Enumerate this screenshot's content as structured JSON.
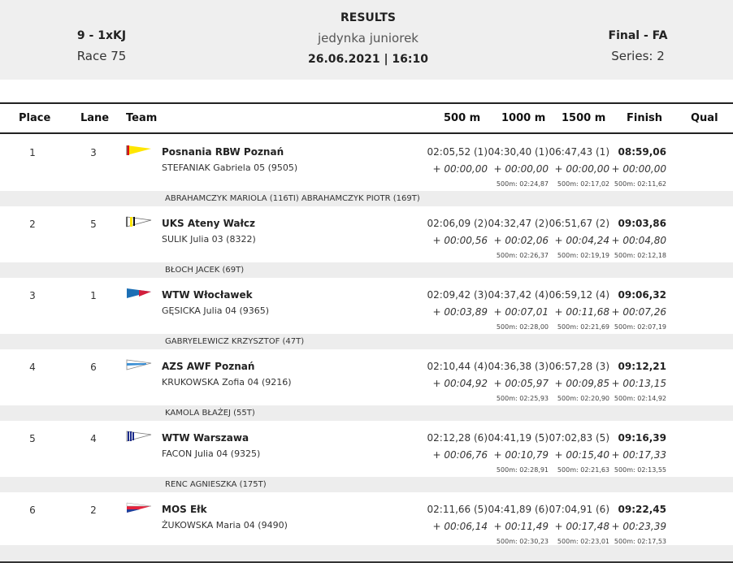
{
  "header": {
    "event_code": "9 - 1xKJ",
    "race": "Race 75",
    "title": "RESULTS",
    "event_name": "jedynka juniorek",
    "datetime": "26.06.2021 | 16:10",
    "phase": "Final - FA",
    "series": "Series: 2"
  },
  "columns": {
    "place": "Place",
    "lane": "Lane",
    "team": "Team",
    "m500": "500 m",
    "m1000": "1000 m",
    "m1500": "1500 m",
    "finish": "Finish",
    "qual": "Qual"
  },
  "rows": [
    {
      "place": "1",
      "lane": "3",
      "flag_icon": "flag-yellow-red",
      "club": "Posnania RBW Poznań",
      "athlete": "STEFANIAK  Gabriela 05 (9505)",
      "t500": "02:05,52 (1)",
      "t1000": "04:30,40 (1)",
      "t1500": "06:47,43 (1)",
      "finish": "08:59,06",
      "d500": "+ 00:00,00",
      "d1000": "+ 00:00,00",
      "d1500": "+ 00:00,00",
      "dfin": "+ 00:00,00",
      "s1000": "500m: 02:24,87",
      "s1500": "500m: 02:17,02",
      "sfin": "500m: 02:11,62",
      "coach": "ABRAHAMCZYK MARIOLA (116TI) ABRAHAMCZYK PIOTR (169T)"
    },
    {
      "place": "2",
      "lane": "5",
      "flag_icon": "flag-white-yellow-stripes",
      "club": "UKS Ateny Wałcz",
      "athlete": "SULIK  Julia 03 (8322)",
      "t500": "02:06,09 (2)",
      "t1000": "04:32,47 (2)",
      "t1500": "06:51,67 (2)",
      "finish": "09:03,86",
      "d500": "+ 00:00,56",
      "d1000": "+ 00:02,06",
      "d1500": "+ 00:04,24",
      "dfin": "+ 00:04,80",
      "s1000": "500m: 02:26,37",
      "s1500": "500m: 02:19,19",
      "sfin": "500m: 02:12,18",
      "coach": "BŁOCH JACEK (69T)"
    },
    {
      "place": "3",
      "lane": "1",
      "flag_icon": "flag-blue-red",
      "club": "WTW Włocławek",
      "athlete": "GĘSICKA  Julia 04 (9365)",
      "t500": "02:09,42 (3)",
      "t1000": "04:37,42 (4)",
      "t1500": "06:59,12 (4)",
      "finish": "09:06,32",
      "d500": "+ 00:03,89",
      "d1000": "+ 00:07,01",
      "d1500": "+ 00:11,68",
      "dfin": "+ 00:07,26",
      "s1000": "500m: 02:28,00",
      "s1500": "500m: 02:21,69",
      "sfin": "500m: 02:07,19",
      "coach": "GABRYELEWICZ KRZYSZTOF (47T)"
    },
    {
      "place": "4",
      "lane": "6",
      "flag_icon": "flag-white-blue",
      "club": "AZS AWF Poznań",
      "athlete": "KRUKOWSKA  Zofia 04 (9216)",
      "t500": "02:10,44 (4)",
      "t1000": "04:36,38 (3)",
      "t1500": "06:57,28 (3)",
      "finish": "09:12,21",
      "d500": "+ 00:04,92",
      "d1000": "+ 00:05,97",
      "d1500": "+ 00:09,85",
      "dfin": "+ 00:13,15",
      "s1000": "500m: 02:25,93",
      "s1500": "500m: 02:20,90",
      "sfin": "500m: 02:14,92",
      "coach": "KAMOLA BŁAŻEJ (55T)"
    },
    {
      "place": "5",
      "lane": "4",
      "flag_icon": "flag-white-blue-stripes",
      "club": "WTW Warszawa",
      "athlete": "FACON  Julia 04 (9325)",
      "t500": "02:12,28 (6)",
      "t1000": "04:41,19 (5)",
      "t1500": "07:02,83 (5)",
      "finish": "09:16,39",
      "d500": "+ 00:06,76",
      "d1000": "+ 00:10,79",
      "d1500": "+ 00:15,40",
      "dfin": "+ 00:17,33",
      "s1000": "500m: 02:28,91",
      "s1500": "500m: 02:21,63",
      "sfin": "500m: 02:13,55",
      "coach": "RENC AGNIESZKA (175T)"
    },
    {
      "place": "6",
      "lane": "2",
      "flag_icon": "flag-white-red-blue",
      "club": "MOS Ełk",
      "athlete": "ŻUKOWSKA  Maria 04 (9490)",
      "t500": "02:11,66 (5)",
      "t1000": "04:41,89 (6)",
      "t1500": "07:04,91 (6)",
      "finish": "09:22,45",
      "d500": "+ 00:06,14",
      "d1000": "+ 00:11,49",
      "d1500": "+ 00:17,48",
      "dfin": "+ 00:23,39",
      "s1000": "500m: 02:30,23",
      "s1500": "500m: 02:23,01",
      "sfin": "500m: 02:17,53",
      "coach": ""
    }
  ]
}
